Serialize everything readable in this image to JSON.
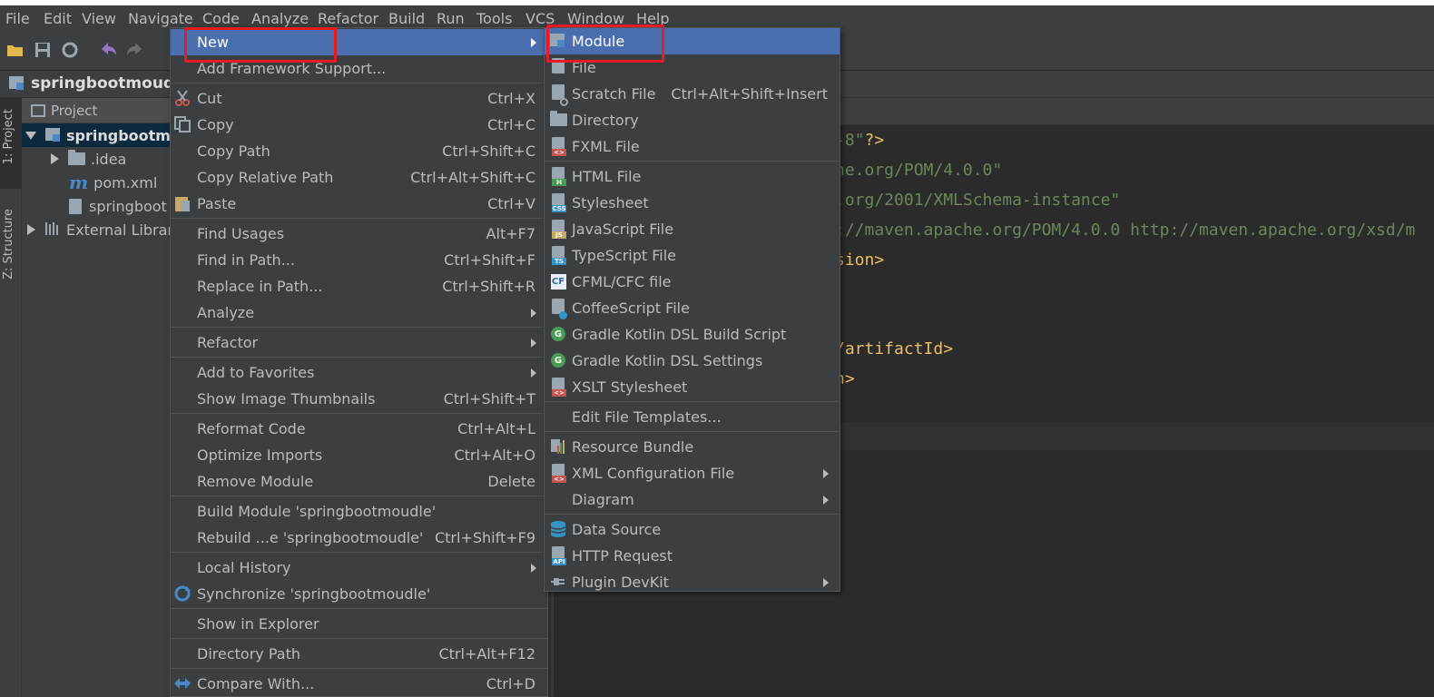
{
  "menubar": {
    "items": [
      "File",
      "Edit",
      "View",
      "Navigate",
      "Code",
      "Analyze",
      "Refactor",
      "Build",
      "Run",
      "Tools",
      "VCS",
      "Window",
      "Help"
    ]
  },
  "navbar": {
    "project_name": "springbootmoudle"
  },
  "left_strip": {
    "project_tab": "1: Project",
    "structure_tab": "Z: Structure"
  },
  "project_panel": {
    "header": "Project",
    "tree": [
      {
        "label": "springbootmo",
        "type": "module",
        "expanded": true,
        "selected": true
      },
      {
        "label": ".idea",
        "type": "folder"
      },
      {
        "label": "pom.xml",
        "type": "maven-file"
      },
      {
        "label": "springboot",
        "type": "iml-file"
      },
      {
        "label": "External Librari",
        "type": "library"
      }
    ]
  },
  "editor": {
    "lines": [
      {
        "parts": [
          {
            "t": "-8\"",
            "c": "str"
          },
          {
            "t": "?>",
            "c": "tag"
          }
        ]
      },
      {
        "parts": [
          {
            "t": "he.org/POM/4.0.0\"",
            "c": "str"
          }
        ]
      },
      {
        "parts": [
          {
            "t": ".org/2001/XMLSchema-instance\"",
            "c": "str"
          }
        ]
      },
      {
        "parts": [
          {
            "t": "://maven.apache.org/POM/4.0.0 http://maven.apache.org/xsd/m",
            "c": "str"
          }
        ]
      },
      {
        "parts": [
          {
            "t": "sion>",
            "c": "tag"
          }
        ]
      },
      {
        "parts": [
          {
            "t": "/artifactId>",
            "c": "tag"
          }
        ]
      },
      {
        "parts": [
          {
            "t": "n>",
            "c": "tag"
          }
        ]
      }
    ]
  },
  "context_menu": {
    "items": [
      {
        "label": "New",
        "shortcut": "",
        "submenu": true,
        "selected": true,
        "icon": ""
      },
      {
        "label": "Add Framework Support...",
        "shortcut": "",
        "icon": ""
      },
      {
        "sep": true
      },
      {
        "label": "Cut",
        "shortcut": "Ctrl+X",
        "icon": "scissors-icon"
      },
      {
        "label": "Copy",
        "shortcut": "Ctrl+C",
        "icon": "copy-icon"
      },
      {
        "label": "Copy Path",
        "shortcut": "Ctrl+Shift+C",
        "icon": ""
      },
      {
        "label": "Copy Relative Path",
        "shortcut": "Ctrl+Alt+Shift+C",
        "icon": ""
      },
      {
        "label": "Paste",
        "shortcut": "Ctrl+V",
        "icon": "paste-icon"
      },
      {
        "sep": true
      },
      {
        "label": "Find Usages",
        "shortcut": "Alt+F7",
        "icon": ""
      },
      {
        "label": "Find in Path...",
        "shortcut": "Ctrl+Shift+F",
        "icon": ""
      },
      {
        "label": "Replace in Path...",
        "shortcut": "Ctrl+Shift+R",
        "icon": ""
      },
      {
        "label": "Analyze",
        "shortcut": "",
        "submenu": true,
        "icon": ""
      },
      {
        "sep": true
      },
      {
        "label": "Refactor",
        "shortcut": "",
        "submenu": true,
        "icon": ""
      },
      {
        "sep": true
      },
      {
        "label": "Add to Favorites",
        "shortcut": "",
        "submenu": true,
        "icon": ""
      },
      {
        "label": "Show Image Thumbnails",
        "shortcut": "Ctrl+Shift+T",
        "icon": ""
      },
      {
        "sep": true
      },
      {
        "label": "Reformat Code",
        "shortcut": "Ctrl+Alt+L",
        "icon": ""
      },
      {
        "label": "Optimize Imports",
        "shortcut": "Ctrl+Alt+O",
        "icon": ""
      },
      {
        "label": "Remove Module",
        "shortcut": "Delete",
        "icon": ""
      },
      {
        "sep": true
      },
      {
        "label": "Build Module 'springbootmoudle'",
        "shortcut": "",
        "icon": ""
      },
      {
        "label": "Rebuild ...e 'springbootmoudle'",
        "shortcut": "Ctrl+Shift+F9",
        "icon": ""
      },
      {
        "sep": true
      },
      {
        "label": "Local History",
        "shortcut": "",
        "submenu": true,
        "icon": ""
      },
      {
        "label": "Synchronize 'springbootmoudle'",
        "shortcut": "",
        "icon": "sync-icon"
      },
      {
        "sep": true
      },
      {
        "label": "Show in Explorer",
        "shortcut": "",
        "icon": ""
      },
      {
        "sep": true
      },
      {
        "label": "Directory Path",
        "shortcut": "Ctrl+Alt+F12",
        "icon": ""
      },
      {
        "sep": true
      },
      {
        "label": "Compare With...",
        "shortcut": "Ctrl+D",
        "icon": "compare-icon"
      }
    ]
  },
  "submenu_new": {
    "items": [
      {
        "label": "Module",
        "selected": true,
        "icon": "module-icon"
      },
      {
        "label": "File",
        "icon": "file-icon"
      },
      {
        "label": "Scratch File",
        "shortcut": "Ctrl+Alt+Shift+Insert",
        "icon": "scratch-file-icon"
      },
      {
        "label": "Directory",
        "icon": "folder-icon"
      },
      {
        "label": "FXML File",
        "icon": "fxml-file-icon"
      },
      {
        "sep": true
      },
      {
        "label": "HTML File",
        "icon": "html-file-icon"
      },
      {
        "label": "Stylesheet",
        "icon": "css-file-icon"
      },
      {
        "label": "JavaScript File",
        "icon": "js-file-icon"
      },
      {
        "label": "TypeScript File",
        "icon": "ts-file-icon"
      },
      {
        "label": "CFML/CFC file",
        "icon": "cf-file-icon"
      },
      {
        "label": "CoffeeScript File",
        "icon": "coffee-file-icon"
      },
      {
        "label": "Gradle Kotlin DSL Build Script",
        "icon": "gradle-icon"
      },
      {
        "label": "Gradle Kotlin DSL Settings",
        "icon": "gradle-icon"
      },
      {
        "label": "XSLT Stylesheet",
        "icon": "xslt-file-icon"
      },
      {
        "sep": true
      },
      {
        "label": "Edit File Templates...",
        "icon": ""
      },
      {
        "sep": true
      },
      {
        "label": "Resource Bundle",
        "icon": "resource-bundle-icon"
      },
      {
        "label": "XML Configuration File",
        "submenu": true,
        "icon": "xml-file-icon"
      },
      {
        "label": "Diagram",
        "submenu": true,
        "icon": ""
      },
      {
        "sep": true
      },
      {
        "label": "Data Source",
        "icon": "database-icon"
      },
      {
        "label": "HTTP Request",
        "icon": "api-file-icon"
      },
      {
        "label": "Plugin DevKit",
        "submenu": true,
        "icon": "plugin-icon"
      }
    ]
  },
  "colors": {
    "selection": "#4b6eaf",
    "highlight_box": "#e51c23",
    "menu_bg": "#3c3f41"
  }
}
